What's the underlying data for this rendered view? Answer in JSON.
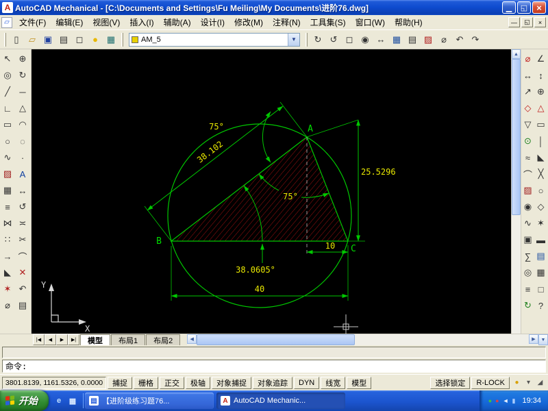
{
  "window": {
    "title": "AutoCAD Mechanical - [C:\\Documents and Settings\\Fu Meiling\\My Documents\\进阶76.dwg]",
    "app_icon_glyph": "A",
    "buttons": [
      {
        "name": "minimize-button",
        "glyph": "▁",
        "cls": ""
      },
      {
        "name": "restore-button",
        "glyph": "◱",
        "cls": ""
      },
      {
        "name": "close-button",
        "glyph": "×",
        "cls": "close"
      }
    ]
  },
  "menubar": {
    "doc_icon": "▱",
    "items": [
      {
        "name": "menu-file",
        "label": "文件(F)"
      },
      {
        "name": "menu-edit",
        "label": "编辑(E)"
      },
      {
        "name": "menu-view",
        "label": "视图(V)"
      },
      {
        "name": "menu-insert",
        "label": "插入(I)"
      },
      {
        "name": "menu-assist",
        "label": "辅助(A)"
      },
      {
        "name": "menu-design",
        "label": "设计(I)"
      },
      {
        "name": "menu-modify",
        "label": "修改(M)"
      },
      {
        "name": "menu-annotate",
        "label": "注释(N)"
      },
      {
        "name": "menu-toolsets",
        "label": "工具集(S)"
      },
      {
        "name": "menu-window",
        "label": "窗口(W)"
      },
      {
        "name": "menu-help",
        "label": "帮助(H)"
      }
    ],
    "mdi_buttons": [
      {
        "name": "mdi-minimize-button",
        "glyph": "―"
      },
      {
        "name": "mdi-restore-button",
        "glyph": "◱"
      },
      {
        "name": "mdi-close-button",
        "glyph": "×"
      }
    ]
  },
  "toolbar": {
    "left_icons": [
      {
        "name": "new-icon",
        "glyph": "▯"
      },
      {
        "name": "open-icon",
        "glyph": "▱",
        "color": "#c09020"
      },
      {
        "name": "save-icon",
        "glyph": "▣",
        "color": "#2040a0"
      },
      {
        "name": "plot-icon",
        "glyph": "▤"
      },
      {
        "name": "plot-preview-icon",
        "glyph": "◻"
      },
      {
        "name": "layer-on-icon",
        "glyph": "●",
        "color": "#e8b800"
      },
      {
        "name": "layer-manager-icon",
        "glyph": "▦",
        "color": "#207070"
      }
    ],
    "layer_combo": {
      "value": "AM_5",
      "arrow": "▼",
      "swatch_style": "background:#e8d000"
    },
    "right_icons": [
      {
        "name": "redraw-icon",
        "glyph": "↻"
      },
      {
        "name": "regen-icon",
        "glyph": "↺"
      },
      {
        "name": "zoom-window-icon",
        "glyph": "◻"
      },
      {
        "name": "zoom-realtime-icon",
        "glyph": "◉"
      },
      {
        "name": "pan-icon",
        "glyph": "↔"
      },
      {
        "name": "table-icon",
        "glyph": "▦",
        "color": "#2050a0"
      },
      {
        "name": "properties-icon",
        "glyph": "▤"
      },
      {
        "name": "hatch-edit-icon",
        "glyph": "▨",
        "color": "#b02020"
      },
      {
        "name": "measure-icon",
        "glyph": "⌀"
      },
      {
        "name": "undo-icon",
        "glyph": "↶"
      },
      {
        "name": "redo-icon",
        "glyph": "↷"
      }
    ]
  },
  "left_toolbar": {
    "icons": [
      {
        "name": "select-icon",
        "glyph": "↖"
      },
      {
        "name": "pan-icon",
        "glyph": "⊕"
      },
      {
        "name": "zoom-icon",
        "glyph": "◎"
      },
      {
        "name": "orbit-icon",
        "glyph": "↻"
      },
      {
        "name": "line-icon",
        "glyph": "╱"
      },
      {
        "name": "xline-icon",
        "glyph": "─"
      },
      {
        "name": "polyline-icon",
        "glyph": "∟"
      },
      {
        "name": "polygon-icon",
        "glyph": "△"
      },
      {
        "name": "rectangle-icon",
        "glyph": "▭"
      },
      {
        "name": "arc-icon",
        "glyph": "◠"
      },
      {
        "name": "circle-icon",
        "glyph": "○"
      },
      {
        "name": "ellipse-icon",
        "glyph": "◌"
      },
      {
        "name": "spline-icon",
        "glyph": "∿"
      },
      {
        "name": "point-icon",
        "glyph": "·"
      },
      {
        "name": "hatch-icon",
        "glyph": "▨",
        "color": "#a02020"
      },
      {
        "name": "text-icon",
        "glyph": "A",
        "color": "#1040a0"
      },
      {
        "name": "table-icon",
        "glyph": "▦"
      },
      {
        "name": "move-icon",
        "glyph": "↔"
      },
      {
        "name": "copy-icon",
        "glyph": "≡"
      },
      {
        "name": "rotate-icon",
        "glyph": "↺"
      },
      {
        "name": "mirror-icon",
        "glyph": "⋈"
      },
      {
        "name": "offset-icon",
        "glyph": "≍"
      },
      {
        "name": "array-icon",
        "glyph": "∷"
      },
      {
        "name": "trim-icon",
        "glyph": "✂"
      },
      {
        "name": "extend-icon",
        "glyph": "→"
      },
      {
        "name": "fillet-icon",
        "glyph": "⌒"
      },
      {
        "name": "chamfer-icon",
        "glyph": "◣"
      },
      {
        "name": "erase-icon",
        "glyph": "✕",
        "color": "#b02020"
      },
      {
        "name": "explode-icon",
        "glyph": "✶",
        "color": "#b02020"
      },
      {
        "name": "undo-icon",
        "glyph": "↶"
      },
      {
        "name": "distance-icon",
        "glyph": "⌀"
      },
      {
        "name": "layers-icon",
        "glyph": "▤"
      }
    ]
  },
  "right_toolbar": {
    "icons": [
      {
        "name": "power-dim-icon",
        "glyph": "⌀",
        "color": "#c02020"
      },
      {
        "name": "angle-dim-icon",
        "glyph": "∠"
      },
      {
        "name": "linear-dim-icon",
        "glyph": "↔"
      },
      {
        "name": "vertical-dim-icon",
        "glyph": "↕"
      },
      {
        "name": "leader-icon",
        "glyph": "↗"
      },
      {
        "name": "tolerance-icon",
        "glyph": "⊕"
      },
      {
        "name": "symbol-icon",
        "glyph": "◇",
        "color": "#c02020"
      },
      {
        "name": "weld-symbol-icon",
        "glyph": "△",
        "color": "#c02020"
      },
      {
        "name": "surface-symbol-icon",
        "glyph": "▽"
      },
      {
        "name": "datum-icon",
        "glyph": "▭"
      },
      {
        "name": "centerline-icon",
        "glyph": "⊙",
        "color": "#208020"
      },
      {
        "name": "axis-icon",
        "glyph": "│"
      },
      {
        "name": "thread-icon",
        "glyph": "≈"
      },
      {
        "name": "chamfer2-icon",
        "glyph": "◣"
      },
      {
        "name": "fillet2-icon",
        "glyph": "⌒"
      },
      {
        "name": "break-icon",
        "glyph": "╳"
      },
      {
        "name": "hatch2-icon",
        "glyph": "▨",
        "color": "#a02020"
      },
      {
        "name": "hole-icon",
        "glyph": "○"
      },
      {
        "name": "bolt-icon",
        "glyph": "◉"
      },
      {
        "name": "nut-icon",
        "glyph": "◇"
      },
      {
        "name": "spring-icon",
        "glyph": "∿"
      },
      {
        "name": "gear-icon",
        "glyph": "✶"
      },
      {
        "name": "bearing-icon",
        "glyph": "▣"
      },
      {
        "name": "shaft-icon",
        "glyph": "▬"
      },
      {
        "name": "calc-icon",
        "glyph": "∑"
      },
      {
        "name": "bom-icon",
        "glyph": "▤",
        "color": "#2050a0"
      },
      {
        "name": "balloon-icon",
        "glyph": "◎"
      },
      {
        "name": "title-block-icon",
        "glyph": "▦"
      },
      {
        "name": "layer-group-icon",
        "glyph": "≡"
      },
      {
        "name": "view-icon",
        "glyph": "□"
      },
      {
        "name": "update-icon",
        "glyph": "↻",
        "color": "#208020"
      },
      {
        "name": "help-icon",
        "glyph": "?"
      }
    ]
  },
  "drawing": {
    "vertices": {
      "a": "A",
      "b": "B",
      "c": "C"
    },
    "dims": {
      "top_angle": "75°",
      "ab_length": "38.102",
      "apex_angle": "75°",
      "ac_length": "25.5296",
      "foot_to_c": "10",
      "b_angle": "38.0605°",
      "bc_length": "40"
    },
    "ucs": {
      "x": "X",
      "y": "Y"
    },
    "colors": {
      "geometry": "#00c800",
      "dim_text": "#e8e800",
      "vertex_text": "#00dd00",
      "hatch": "#a01010"
    }
  },
  "scroll": {
    "up": "▲",
    "down": "▼",
    "left": "◀",
    "right": "▶"
  },
  "tabs": {
    "nav": [
      {
        "name": "tab-first-button",
        "glyph": "|◀"
      },
      {
        "name": "tab-prev-button",
        "glyph": "◀"
      },
      {
        "name": "tab-next-button",
        "glyph": "▶"
      },
      {
        "name": "tab-last-button",
        "glyph": "▶|"
      }
    ],
    "items": [
      {
        "name": "tab-model",
        "label": "模型",
        "cls": "active"
      },
      {
        "name": "tab-layout1",
        "label": "布局1",
        "cls": ""
      },
      {
        "name": "tab-layout2",
        "label": "布局2",
        "cls": ""
      }
    ]
  },
  "command": {
    "prompt": "命令:"
  },
  "statusbar": {
    "coords": "3801.8139, 1161.5326, 0.0000",
    "toggles": [
      {
        "name": "toggle-snap",
        "label": "捕捉"
      },
      {
        "name": "toggle-grid",
        "label": "栅格"
      },
      {
        "name": "toggle-ortho",
        "label": "正交"
      },
      {
        "name": "toggle-polar",
        "label": "极轴"
      },
      {
        "name": "toggle-osnap",
        "label": "对象捕捉"
      },
      {
        "name": "toggle-otrack",
        "label": "对象追踪"
      },
      {
        "name": "toggle-dyn",
        "label": "DYN"
      },
      {
        "name": "toggle-lineweight",
        "label": "线宽"
      },
      {
        "name": "toggle-model",
        "label": "模型"
      }
    ],
    "lock_button": "选择锁定",
    "rlock_button": "R-LOCK",
    "right_icons": [
      {
        "name": "annotation-lock-icon",
        "glyph": "●",
        "color": "#d8a000"
      },
      {
        "name": "toolbar-options-icon",
        "glyph": "▾"
      },
      {
        "name": "resize-grip-icon",
        "glyph": "◢"
      }
    ]
  },
  "taskbar": {
    "start_label": "开始",
    "quicklaunch": [
      {
        "name": "ie-quicklaunch-icon",
        "glyph": "e",
        "color": "#bfe0ff"
      },
      {
        "name": "show-desktop-icon",
        "glyph": "▦",
        "color": "#d8e8ff"
      }
    ],
    "tasks": [
      {
        "name": "task-document",
        "label": "【进阶级练习题76...",
        "cls": "",
        "icon_glyph": "▤",
        "icon_color": "#2a5fdc"
      },
      {
        "name": "task-autocad",
        "label": "AutoCAD Mechanic...",
        "cls": "active",
        "icon_glyph": "A",
        "icon_color": "#c42010"
      }
    ],
    "tray_icons": [
      {
        "name": "antivirus-tray-icon",
        "glyph": "●",
        "color": "#40c040"
      },
      {
        "name": "alert-tray-icon",
        "glyph": "●",
        "color": "#e04040"
      },
      {
        "name": "volume-tray-icon",
        "glyph": "◄",
        "color": "#e8f0ff"
      },
      {
        "name": "network-tray-icon",
        "glyph": "▮",
        "color": "#a8ccff"
      }
    ],
    "time": "19:34"
  }
}
